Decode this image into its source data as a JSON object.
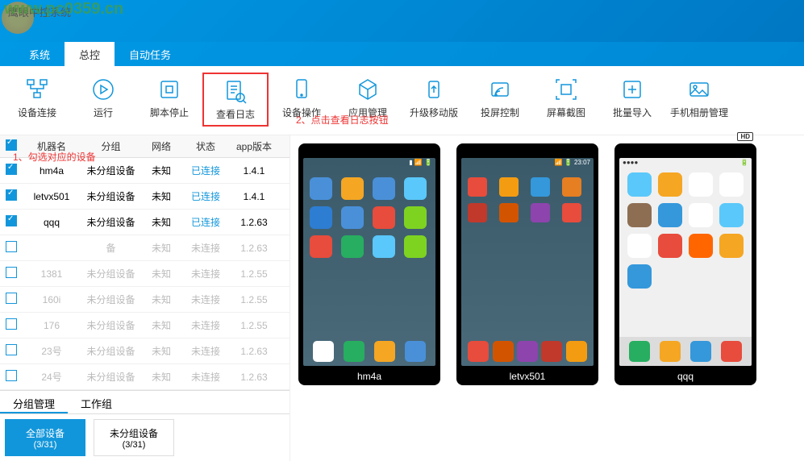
{
  "app_title": "鹰眼中控系统",
  "watermark": "www.pc0359.cn",
  "main_tabs": [
    {
      "label": "系统",
      "active": false
    },
    {
      "label": "总控",
      "active": true
    },
    {
      "label": "自动任务",
      "active": false
    }
  ],
  "toolbar": [
    {
      "label": "设备连接",
      "icon": "connect"
    },
    {
      "label": "运行",
      "icon": "play"
    },
    {
      "label": "脚本停止",
      "icon": "stop"
    },
    {
      "label": "查看日志",
      "icon": "log",
      "highlight": true
    },
    {
      "label": "设备操作",
      "icon": "device"
    },
    {
      "label": "应用管理",
      "icon": "app"
    },
    {
      "label": "升级移动版",
      "icon": "upgrade"
    },
    {
      "label": "投屏控制",
      "icon": "cast"
    },
    {
      "label": "屏幕截图",
      "icon": "screenshot"
    },
    {
      "label": "批量导入",
      "icon": "import"
    },
    {
      "label": "手机相册管理",
      "icon": "album"
    }
  ],
  "annotations": {
    "a1": "1、勾选对应的设备",
    "a2": "2、点击查看日志按钮"
  },
  "table": {
    "headers": {
      "name": "机器名",
      "group": "分组",
      "network": "网络",
      "status": "状态",
      "version": "app版本"
    },
    "rows": [
      {
        "checked": true,
        "name": "hm4a",
        "group": "未分组设备",
        "network": "未知",
        "status": "已连接",
        "version": "1.4.1",
        "active": true
      },
      {
        "checked": true,
        "name": "letvx501",
        "group": "未分组设备",
        "network": "未知",
        "status": "已连接",
        "version": "1.4.1",
        "active": true
      },
      {
        "checked": true,
        "name": "qqq",
        "group": "未分组设备",
        "network": "未知",
        "status": "已连接",
        "version": "1.2.63",
        "active": true
      },
      {
        "checked": false,
        "name": "",
        "group": "备",
        "network": "未知",
        "status": "未连接",
        "version": "1.2.63",
        "active": false
      },
      {
        "checked": false,
        "name": "1381",
        "group": "未分组设备",
        "network": "未知",
        "status": "未连接",
        "version": "1.2.55",
        "active": false
      },
      {
        "checked": false,
        "name": "160i",
        "group": "未分组设备",
        "network": "未知",
        "status": "未连接",
        "version": "1.2.55",
        "active": false
      },
      {
        "checked": false,
        "name": "176",
        "group": "未分组设备",
        "network": "未知",
        "status": "未连接",
        "version": "1.2.55",
        "active": false
      },
      {
        "checked": false,
        "name": "23号",
        "group": "未分组设备",
        "network": "未知",
        "status": "未连接",
        "version": "1.2.63",
        "active": false
      },
      {
        "checked": false,
        "name": "24号",
        "group": "未分组设备",
        "network": "未知",
        "status": "未连接",
        "version": "1.2.63",
        "active": false
      }
    ]
  },
  "bottom_tabs": [
    {
      "label": "分组管理",
      "active": true
    },
    {
      "label": "工作组",
      "active": false
    }
  ],
  "group_buttons": [
    {
      "label": "全部设备",
      "count": "(3/31)",
      "active": true
    },
    {
      "label": "未分组设备",
      "count": "(3/31)",
      "active": false
    }
  ],
  "phones": [
    {
      "name": "hm4a",
      "type": "android1"
    },
    {
      "name": "letvx501",
      "type": "android2"
    },
    {
      "name": "qqq",
      "type": "ios",
      "hd": "HD"
    }
  ]
}
